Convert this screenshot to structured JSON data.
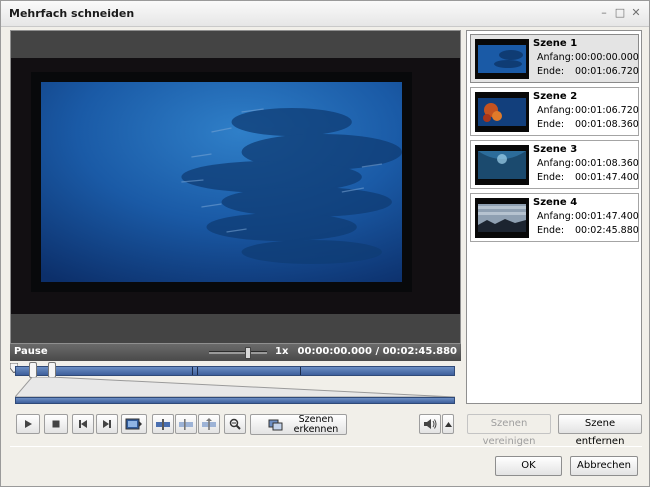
{
  "window": {
    "title": "Mehrfach schneiden",
    "controls": {
      "minimize": "–",
      "maximize": "□",
      "close": "✕"
    }
  },
  "player": {
    "status": "Pause",
    "speed": "1x",
    "speed_level": 0.7,
    "time": "00:00:00.000 / 00:02:45.880"
  },
  "timeline": {
    "duration_s": 165.88,
    "cuts_s": [
      66.72,
      68.36,
      107.4
    ],
    "selection_s": [
      6.5,
      13.5
    ]
  },
  "toolbar": {
    "play_icon": "play-icon",
    "stop_icon": "stop-icon",
    "prev_icon": "skip-back-icon",
    "next_icon": "skip-forward-icon",
    "scene_detect_label": "Szenen\nerkennen"
  },
  "scenes": [
    {
      "name": "Szene 1",
      "start_label": "Anfang:",
      "start": "00:00:00.000",
      "end_label": "Ende:",
      "end": "00:01:06.720",
      "selected": true
    },
    {
      "name": "Szene 2",
      "start_label": "Anfang:",
      "start": "00:01:06.720",
      "end_label": "Ende:",
      "end": "00:01:08.360",
      "selected": false
    },
    {
      "name": "Szene 3",
      "start_label": "Anfang:",
      "start": "00:01:08.360",
      "end_label": "Ende:",
      "end": "00:01:47.400",
      "selected": false
    },
    {
      "name": "Szene 4",
      "start_label": "Anfang:",
      "start": "00:01:47.400",
      "end_label": "Ende:",
      "end": "00:02:45.880",
      "selected": false
    }
  ],
  "scene_buttons": {
    "merge": "Szenen vereinigen",
    "remove": "Szene entfernen"
  },
  "dialog": {
    "ok": "OK",
    "cancel": "Abbrechen"
  },
  "colors": {
    "timeline": "#4a6fb0",
    "status_bar": "#555555"
  }
}
